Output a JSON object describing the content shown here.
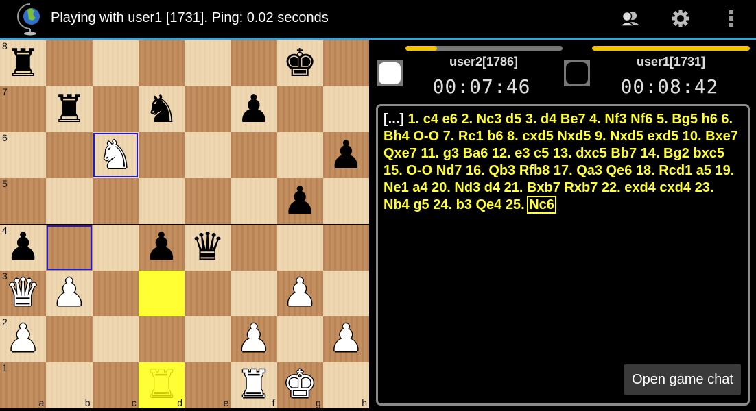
{
  "actionbar": {
    "app_icon": "globe-chess-icon",
    "title": "Playing with user1 [1731]. Ping: 0.02 seconds",
    "buttons": [
      {
        "name": "players-button",
        "icon": "users-icon"
      },
      {
        "name": "settings-button",
        "icon": "gear-icon"
      },
      {
        "name": "overflow-menu-button",
        "icon": "more-vert-icon"
      }
    ],
    "accent_color": "#33a8d6"
  },
  "players": {
    "left": {
      "name": "user2[1786]",
      "clock": "00:07:46",
      "color": "white",
      "time_fraction": 0.2
    },
    "right": {
      "name": "user1[1731]",
      "clock": "00:08:42",
      "color": "black",
      "time_fraction": 1.0
    }
  },
  "moves": {
    "prefix": "[...]",
    "text": " 1. c4 e6 2. Nc3 d5 3. d4 Be7 4. Nf3 Nf6 5. Bg5 h6 6. Bh4 O-O 7. Rc1 b6 8. cxd5 Nxd5 9. Nxd5 exd5 10. Bxe7 Qxe7 11. g3 Ba6 12. e3 c5 13. dxc5 Bb7 14. Bg2 bxc5 15. O-O Nd7 16. Qb3 Rfb8 17. Qa3 Qe6 18. Rcd1 a5 19. Ne1 a4 20. Nd3 d4 21. Bxb7 Rxb7 22. exd4 cxd4 23. Nb4 g5 24. b3 Qe4 25. ",
    "current": "Nc6"
  },
  "chat_button": "Open game chat",
  "board": {
    "files": [
      "a",
      "b",
      "c",
      "d",
      "e",
      "f",
      "g",
      "h"
    ],
    "ranks": [
      "8",
      "7",
      "6",
      "5",
      "4",
      "3",
      "2",
      "1"
    ],
    "pieces": [
      {
        "sq": "a8",
        "piece": "rook",
        "color": "b",
        "glyph": "♜"
      },
      {
        "sq": "g8",
        "piece": "king",
        "color": "b",
        "glyph": "♚"
      },
      {
        "sq": "b7",
        "piece": "rook",
        "color": "b",
        "glyph": "♜"
      },
      {
        "sq": "d7",
        "piece": "knight",
        "color": "b",
        "glyph": "♞"
      },
      {
        "sq": "f7",
        "piece": "pawn",
        "color": "b",
        "glyph": "♟"
      },
      {
        "sq": "c6",
        "piece": "knight",
        "color": "w",
        "glyph": "♞"
      },
      {
        "sq": "h6",
        "piece": "pawn",
        "color": "b",
        "glyph": "♟"
      },
      {
        "sq": "g5",
        "piece": "pawn",
        "color": "b",
        "glyph": "♟"
      },
      {
        "sq": "a4",
        "piece": "pawn",
        "color": "b",
        "glyph": "♟"
      },
      {
        "sq": "d4",
        "piece": "pawn",
        "color": "b",
        "glyph": "♟"
      },
      {
        "sq": "e4",
        "piece": "queen",
        "color": "b",
        "glyph": "♛"
      },
      {
        "sq": "a3",
        "piece": "queen",
        "color": "w",
        "glyph": "♛"
      },
      {
        "sq": "b3",
        "piece": "pawn",
        "color": "w",
        "glyph": "♟"
      },
      {
        "sq": "g3",
        "piece": "pawn",
        "color": "w",
        "glyph": "♟"
      },
      {
        "sq": "a2",
        "piece": "pawn",
        "color": "w",
        "glyph": "♟"
      },
      {
        "sq": "f2",
        "piece": "pawn",
        "color": "w",
        "glyph": "♟"
      },
      {
        "sq": "h2",
        "piece": "pawn",
        "color": "w",
        "glyph": "♟"
      },
      {
        "sq": "d1",
        "piece": "rook",
        "color": "ghost",
        "glyph": "♜"
      },
      {
        "sq": "f1",
        "piece": "rook",
        "color": "w",
        "glyph": "♜"
      },
      {
        "sq": "g1",
        "piece": "king",
        "color": "w",
        "glyph": "♚"
      }
    ],
    "highlight_yellow": [
      "d3",
      "d1"
    ],
    "highlight_blue": [
      "c6",
      "b4"
    ]
  }
}
